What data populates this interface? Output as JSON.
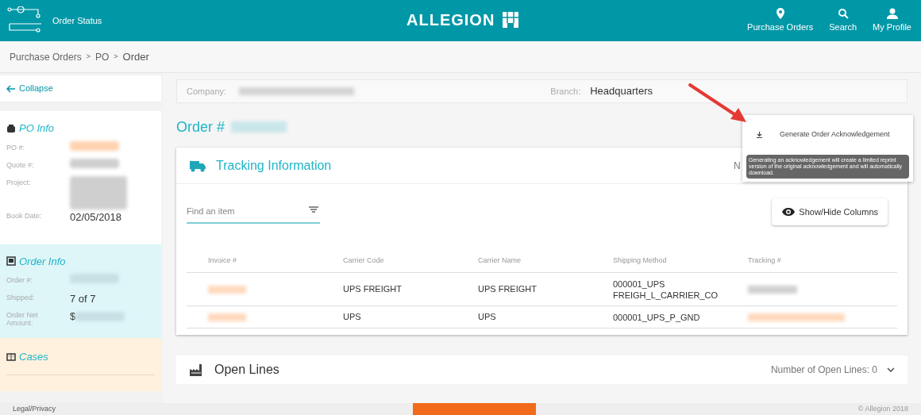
{
  "header": {
    "app_title": "Order Status",
    "brand": "ALLEGION",
    "nav": [
      {
        "kind": "pin",
        "label": "Purchase Orders"
      },
      {
        "kind": "search",
        "label": "Search"
      },
      {
        "kind": "person",
        "label": "My Profile"
      }
    ]
  },
  "breadcrumb": {
    "separator": ">",
    "items": [
      "Purchase Orders",
      "PO",
      "Order"
    ]
  },
  "sidebar": {
    "collapse": "Collapse",
    "sections": [
      {
        "kind": "po",
        "title": "PO Info",
        "fields": [
          {
            "label": "PO #:",
            "redacted": true,
            "color": "#ffd2b0"
          },
          {
            "label": "Quote #:",
            "redacted": true,
            "color": "#cfcfcf"
          },
          {
            "label": "Project:",
            "redacted": true,
            "color": "#cfcfcf",
            "tall": true
          },
          {
            "label": "Book Date:",
            "value": "02/05/2018"
          }
        ]
      },
      {
        "kind": "order",
        "title": "Order Info",
        "fields": [
          {
            "label": "Order #:",
            "redacted": true,
            "color": "#c7dfe3"
          },
          {
            "label": "Shipped:",
            "value": "7 of 7"
          },
          {
            "label": "Order Net Amount:",
            "value": "$",
            "redacted": true,
            "color": "#c7dfe3"
          }
        ]
      },
      {
        "kind": "cases",
        "title": "Cases"
      }
    ]
  },
  "company_bar": {
    "company_label": "Company:",
    "branch_label": "Branch:",
    "branch": "Headquarters"
  },
  "order_title": "Order #",
  "tracking": {
    "title": "Tracking Information",
    "hidden_text": "N",
    "search": {
      "placeholder": "Find an item"
    },
    "show_hide": "Show/Hide Columns",
    "columns": [
      "Invoice #",
      "Carrier Code",
      "Carrier Name",
      "Shipping Method",
      "Tracking #"
    ],
    "rows": [
      {
        "carrier_code": "UPS FREIGHT",
        "carrier_name": "UPS FREIGHT",
        "shipping_method": [
          "000001_UPS",
          "FREIGH_L_CARRIER_CO"
        ],
        "color": "#d0d0d0"
      },
      {
        "carrier_code": "UPS",
        "carrier_name": "UPS",
        "shipping_method": [
          "000001_UPS_P_GND"
        ],
        "color": "#ffd9bd"
      }
    ]
  },
  "open_lines": {
    "title": "Open Lines",
    "count": "Number of Open Lines: 0"
  },
  "popup": {
    "action": "Generate Order Acknowledgement",
    "tooltip": "Generating an acknowledgement will create a limited reprint version of the original acknowledgement and will automatically download."
  },
  "footer": {
    "link": "Legal/Privacy",
    "copyright": "© Allegion 2018"
  }
}
